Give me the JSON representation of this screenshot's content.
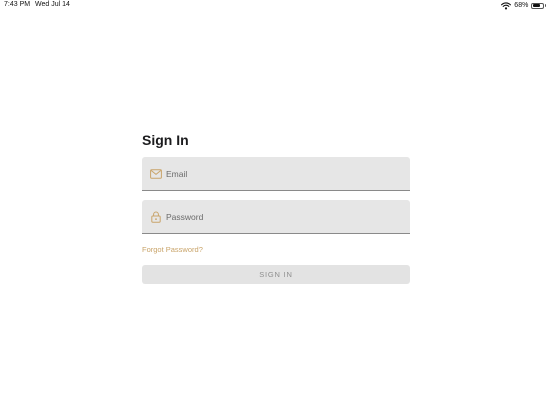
{
  "status_bar": {
    "time": "7:43 PM",
    "date": "Wed Jul 14",
    "battery_percent": "68%",
    "battery_level": 0.68,
    "icons": [
      "wifi-icon",
      "battery-icon"
    ]
  },
  "form": {
    "title": "Sign In",
    "email": {
      "placeholder": "Email",
      "value": "",
      "icon": "mail-icon"
    },
    "password": {
      "placeholder": "Password",
      "value": "",
      "icon": "lock-icon"
    },
    "forgot_password_label": "Forgot Password?",
    "submit_label": "SIGN IN",
    "submit_enabled": false
  },
  "colors": {
    "accent": "#c9a46a",
    "field_background": "#e6e6e6",
    "button_background": "#e3e3e3",
    "button_text": "#8e8e8e"
  }
}
